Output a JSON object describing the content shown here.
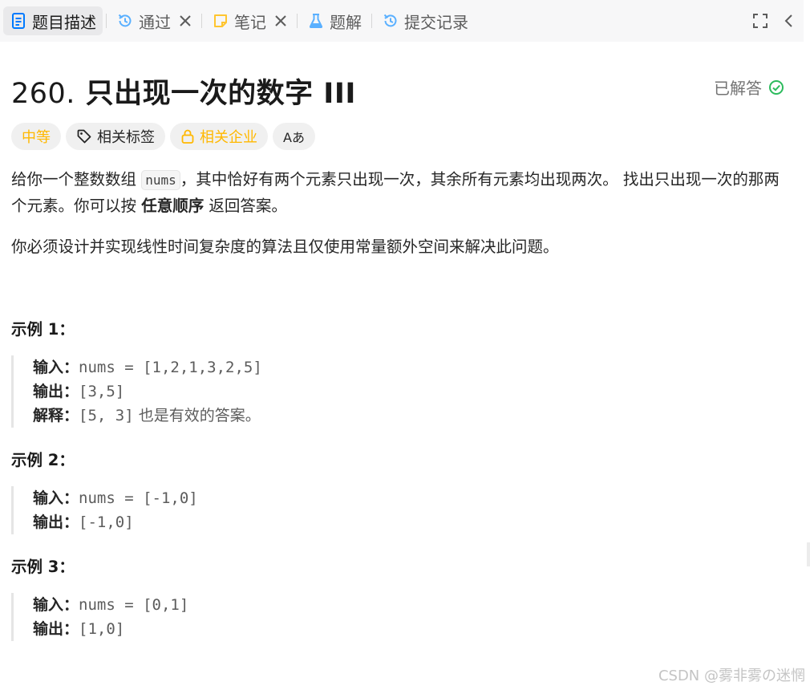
{
  "tabs": [
    {
      "label": "题目描述",
      "icon": "document-icon"
    },
    {
      "label": "通过",
      "icon": "history-icon"
    },
    {
      "label": "笔记",
      "icon": "note-icon"
    },
    {
      "label": "题解",
      "icon": "flask-icon"
    },
    {
      "label": "提交记录",
      "icon": "history-icon"
    }
  ],
  "problem": {
    "number": "260.",
    "title": "只出现一次的数字 III",
    "status": "已解答"
  },
  "tags": {
    "difficulty": "中等",
    "topics": "相关标签",
    "companies": "相关企业",
    "translate": "Aあ"
  },
  "description": {
    "p1_a": "给你一个整数数组 ",
    "p1_code": "nums",
    "p1_b": "，其中恰好有两个元素只出现一次，其余所有元素均出现两次。 找出只出现一次的那两个元素。你可以按 ",
    "p1_bold": "任意顺序",
    "p1_c": " 返回答案。",
    "p2": "你必须设计并实现线性时间复杂度的算法且仅使用常量额外空间来解决此问题。"
  },
  "examples": [
    {
      "title": "示例 1：",
      "input_label": "输入：",
      "input": "nums = [1,2,1,3,2,5]",
      "output_label": "输出：",
      "output": "[3,5]",
      "explain_label": "解释：",
      "explain_code": "[5, 3]",
      "explain_text": " 也是有效的答案。"
    },
    {
      "title": "示例 2：",
      "input_label": "输入：",
      "input": "nums = [-1,0]",
      "output_label": "输出：",
      "output": "[-1,0]"
    },
    {
      "title": "示例 3：",
      "input_label": "输入：",
      "input": "nums = [0,1]",
      "output_label": "输出：",
      "output": "[1,0]"
    }
  ],
  "watermark": "CSDN @雾非雾の迷惘",
  "colors": {
    "accent_blue": "#007aff",
    "solved_green": "#2cbb5d",
    "medium_yellow": "#ffb800"
  }
}
